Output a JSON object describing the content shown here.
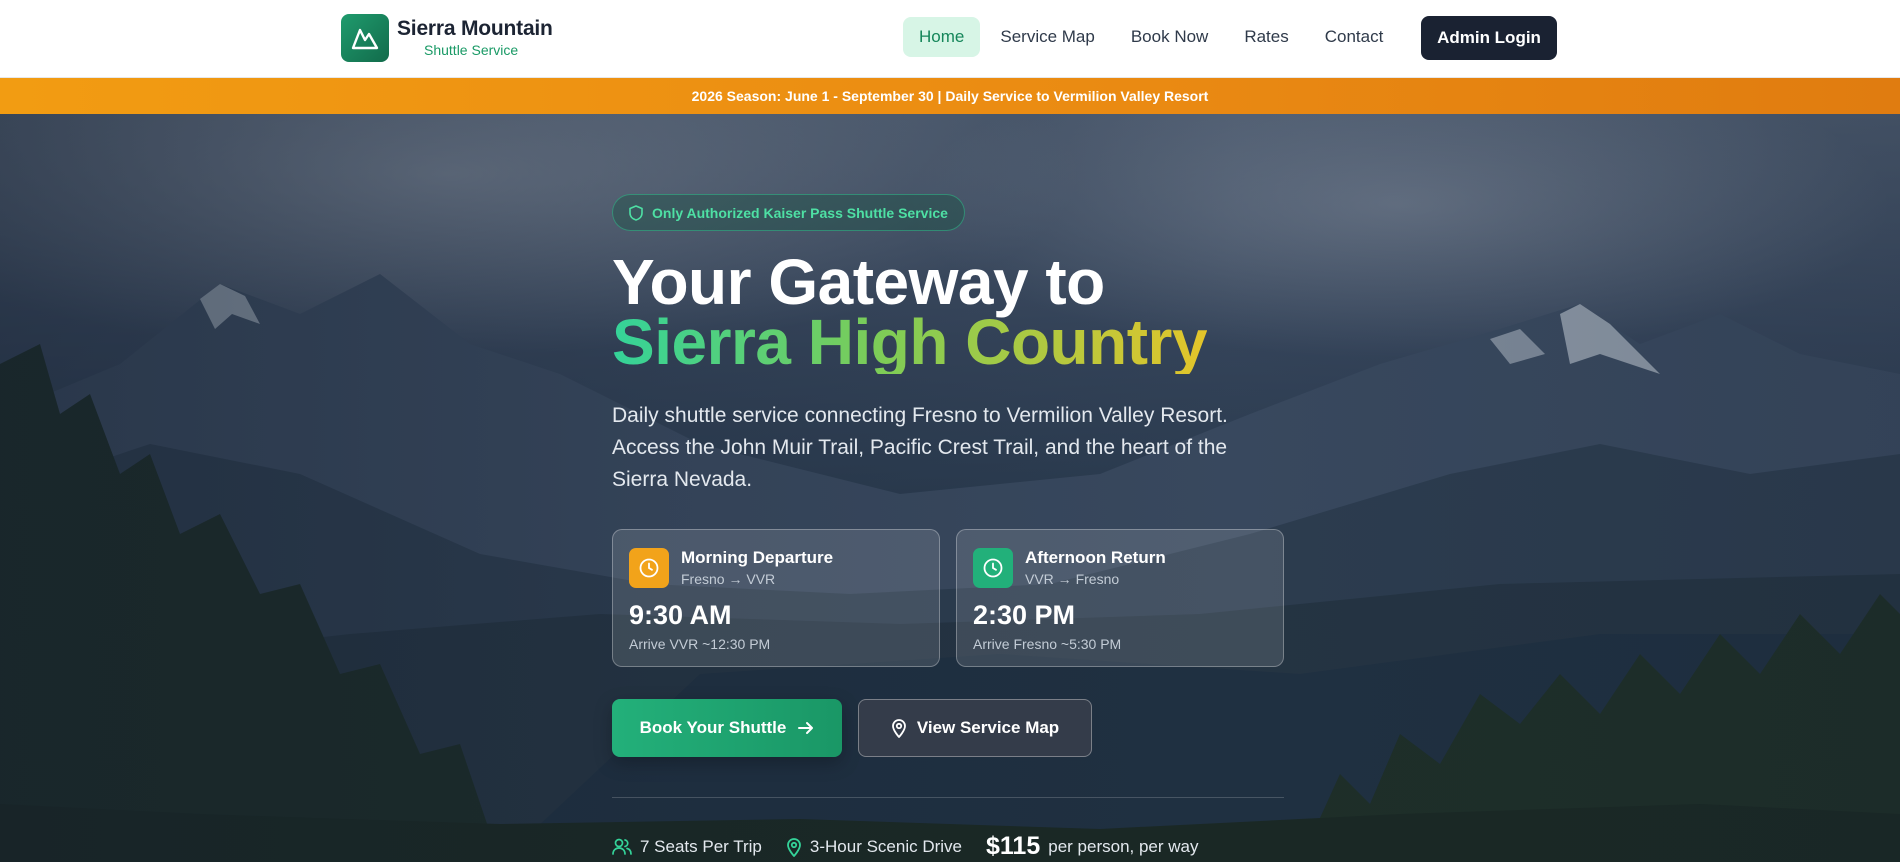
{
  "brand": {
    "title": "Sierra Mountain",
    "subtitle": "Shuttle Service",
    "logo_icon": "mountain-icon"
  },
  "nav": {
    "items": [
      {
        "label": "Home",
        "active": true
      },
      {
        "label": "Service Map",
        "active": false
      },
      {
        "label": "Book Now",
        "active": false
      },
      {
        "label": "Rates",
        "active": false
      },
      {
        "label": "Contact",
        "active": false
      }
    ],
    "admin_label": "Admin Login"
  },
  "banner": {
    "text": "2026 Season: June 1 - September 30 | Daily Service to Vermilion Valley Resort"
  },
  "hero": {
    "badge": "Only Authorized Kaiser Pass Shuttle Service",
    "title_line1": "Your Gateway to",
    "title_line2": "Sierra High Country",
    "lead": "Daily shuttle service connecting Fresno to Vermilion Valley Resort. Access the John Muir Trail, Pacific Crest Trail, and the heart of the Sierra Nevada.",
    "departures": [
      {
        "title": "Morning Departure",
        "route": "Fresno → VVR",
        "time": "9:30 AM",
        "arrive": "Arrive VVR ~12:30 PM",
        "icon": "clock-icon",
        "color": "#f2a31a"
      },
      {
        "title": "Afternoon Return",
        "route": "VVR → Fresno",
        "time": "2:30 PM",
        "arrive": "Arrive Fresno ~5:30 PM",
        "icon": "clock-icon",
        "color": "#22b07a"
      }
    ],
    "primary_cta": "Book Your Shuttle",
    "secondary_cta": "View Service Map",
    "stats": {
      "seats": "7 Seats Per Trip",
      "drive": "3-Hour Scenic Drive",
      "price": "$115",
      "price_note": "per person, per way"
    }
  },
  "colors": {
    "accent_green": "#22b07a",
    "accent_amber": "#f29c12",
    "dark": "#1a2232"
  }
}
